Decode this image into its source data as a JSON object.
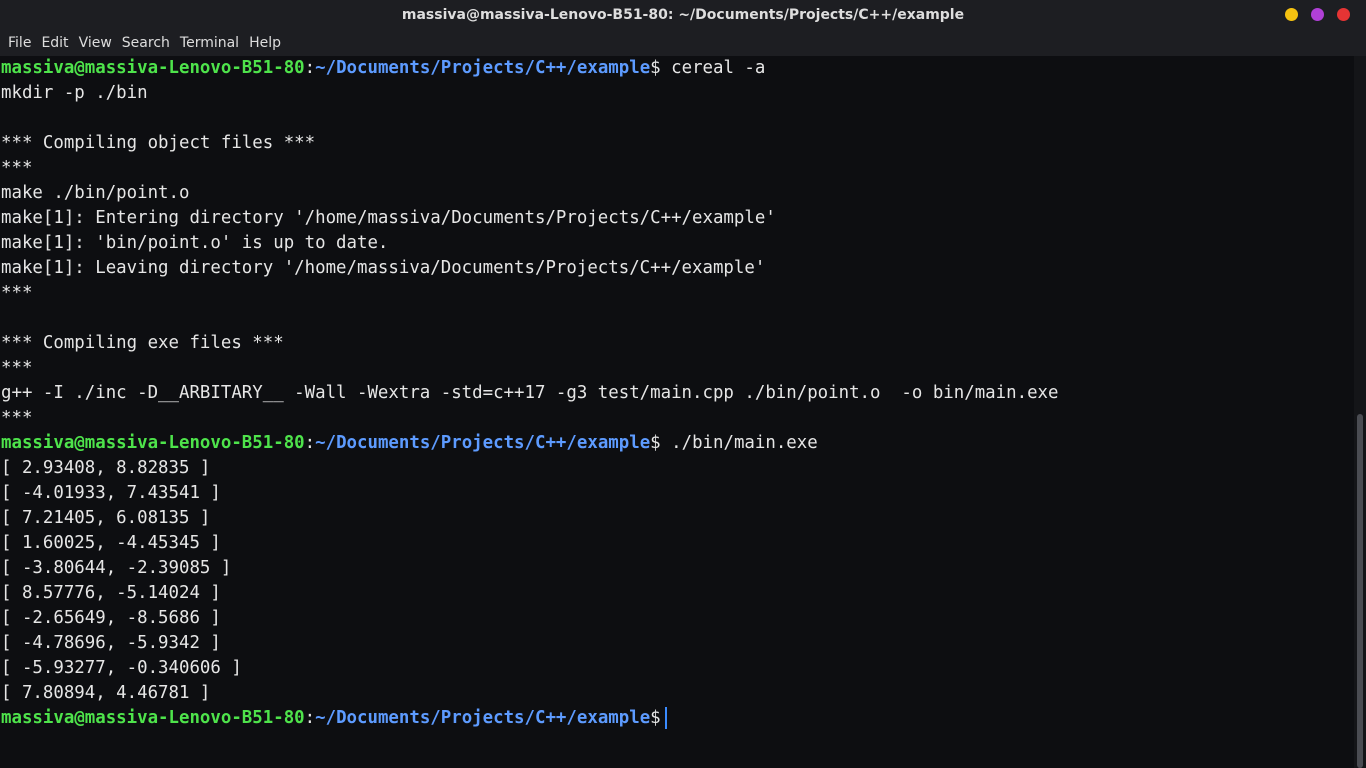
{
  "window": {
    "title": "massiva@massiva-Lenovo-B51-80: ~/Documents/Projects/C++/example",
    "controls": [
      {
        "name": "minimize",
        "color": "#f5c211"
      },
      {
        "name": "maximize",
        "color": "#b040d6"
      },
      {
        "name": "close",
        "color": "#e53434"
      }
    ]
  },
  "menu": [
    "File",
    "Edit",
    "View",
    "Search",
    "Terminal",
    "Help"
  ],
  "prompt": {
    "user": "massiva@massiva-Lenovo-B51-80",
    "sep": ":",
    "path": "~/Documents/Projects/C++/example",
    "symbol": "$"
  },
  "commands": {
    "first": " cereal -a",
    "second": " ./bin/main.exe"
  },
  "output_compile": [
    "mkdir -p ./bin",
    "",
    "*** Compiling object files ***",
    "***",
    "make ./bin/point.o",
    "make[1]: Entering directory '/home/massiva/Documents/Projects/C++/example'",
    "make[1]: 'bin/point.o' is up to date.",
    "make[1]: Leaving directory '/home/massiva/Documents/Projects/C++/example'",
    "***",
    "",
    "*** Compiling exe files ***",
    "***",
    "g++ -I ./inc -D__ARBITARY__ -Wall -Wextra -std=c++17 -g3 test/main.cpp ./bin/point.o  -o bin/main.exe",
    "***"
  ],
  "output_run": [
    "[ 2.93408, 8.82835 ]",
    "[ -4.01933, 7.43541 ]",
    "[ 7.21405, 6.08135 ]",
    "[ 1.60025, -4.45345 ]",
    "[ -3.80644, -2.39085 ]",
    "[ 8.57776, -5.14024 ]",
    "[ -2.65649, -8.5686 ]",
    "[ -4.78696, -5.9342 ]",
    "[ -5.93277, -0.340606 ]",
    "[ 7.80894, 4.46781 ]"
  ],
  "colors": {
    "background": "#0d0e11",
    "user": "#4ee34b",
    "path": "#5d9bff",
    "text": "#e6e6e6",
    "cursor": "#3a8bff"
  }
}
